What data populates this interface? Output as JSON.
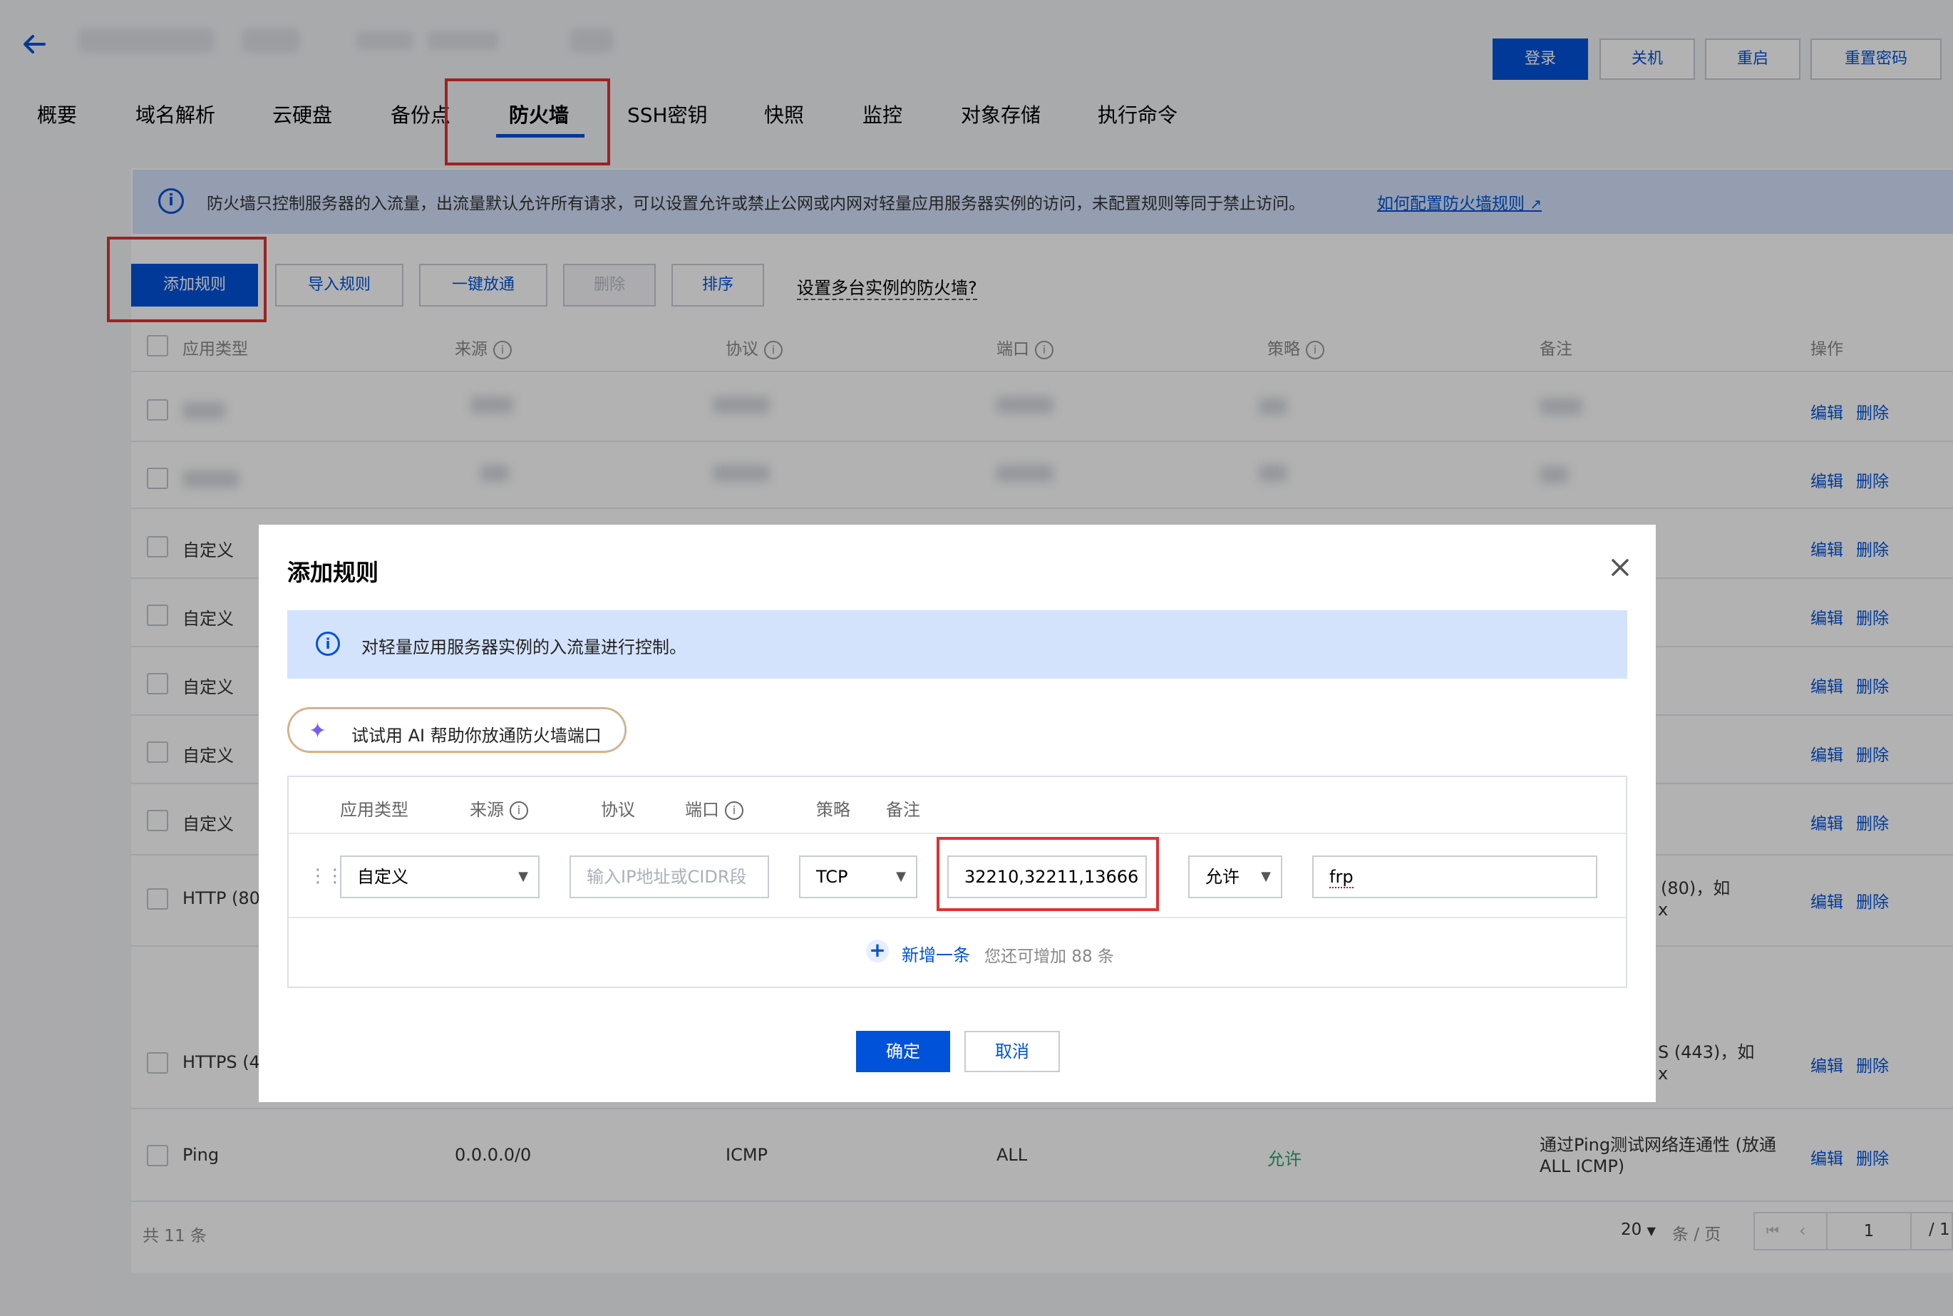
{
  "header": {
    "buttons": [
      "登录",
      "关机",
      "重启",
      "重置密码"
    ]
  },
  "tabs": [
    "概要",
    "域名解析",
    "云硬盘",
    "备份点",
    "防火墙",
    "SSH密钥",
    "快照",
    "监控",
    "对象存储",
    "执行命令"
  ],
  "active_tab": "防火墙",
  "notice": {
    "text": "防火墙只控制服务器的入流量，出流量默认允许所有请求，可以设置允许或禁止公网或内网对轻量应用服务器实例的访问，未配置规则等同于禁止访问。",
    "link": "如何配置防火墙规则"
  },
  "toolbar": {
    "add": "添加规则",
    "import": "导入规则",
    "open_all": "一键放通",
    "delete": "删除",
    "sort": "排序",
    "multi_link": "设置多台实例的防火墙?"
  },
  "table": {
    "headers": [
      "应用类型",
      "来源",
      "协议",
      "端口",
      "策略",
      "备注",
      "操作"
    ],
    "rows": [
      {
        "type": "自定义"
      },
      {
        "type": "自定义"
      },
      {
        "type": "自定义"
      },
      {
        "type": "自定义"
      },
      {
        "type": "自定义"
      },
      {
        "type": "HTTP (80",
        "note": "(80)，如",
        "note2": "x"
      },
      {
        "type": "HTTPS (4",
        "note": "S (443)，如",
        "note2": "x"
      },
      {
        "type": "Ping",
        "source": "0.0.0.0/0",
        "protocol": "ICMP",
        "port": "ALL",
        "policy": "允许",
        "note": "通过Ping测试网络连通性 (放通",
        "note2": "ALL ICMP)"
      }
    ],
    "edit_label": "编辑",
    "delete_label": "删除"
  },
  "footer": {
    "total": "共 11 条",
    "page_size": "20",
    "page_size_unit": "条 / 页",
    "page_input": "1",
    "page_total": "/ 1"
  },
  "modal": {
    "title": "添加规则",
    "info": "对轻量应用服务器实例的入流量进行控制。",
    "ai_button": "试试用 AI 帮助你放通防火墙端口",
    "headers": {
      "type": "应用类型",
      "source": "来源",
      "protocol": "协议",
      "port": "端口",
      "policy": "策略",
      "note": "备注"
    },
    "row": {
      "type": "自定义",
      "source_placeholder": "输入IP地址或CIDR段",
      "protocol": "TCP",
      "port": "32210,32211,13666",
      "policy": "允许",
      "note": "frp"
    },
    "add_row": "新增一条",
    "add_row_hint": "您还可增加 88 条",
    "ok": "确定",
    "cancel": "取消"
  },
  "colors": {
    "primary": "#0052d9",
    "highlight": "#e03131",
    "allow": "#2ba471"
  }
}
